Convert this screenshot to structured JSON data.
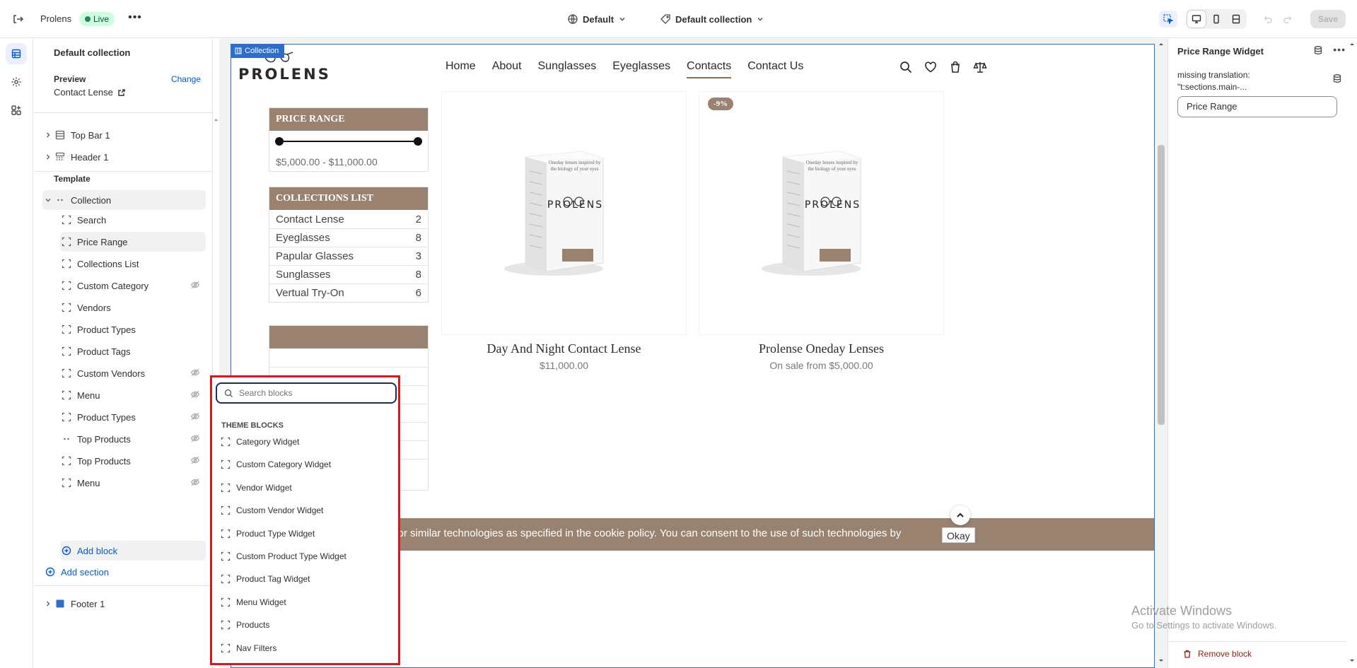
{
  "topbar": {
    "store_name": "Prolens",
    "live_badge": "Live",
    "theme_select": "Default",
    "template_select": "Default collection",
    "save_label": "Save"
  },
  "sidebar": {
    "title": "Default collection",
    "preview_label": "Preview",
    "change_label": "Change",
    "preview_value": "Contact Lense",
    "top_items": [
      {
        "label": "Top Bar 1"
      },
      {
        "label": "Header 1"
      }
    ],
    "template_label": "Template",
    "section": "Collection",
    "blocks": [
      {
        "label": "Search",
        "hidden": false
      },
      {
        "label": "Price Range",
        "hidden": false
      },
      {
        "label": "Collections List",
        "hidden": false
      },
      {
        "label": "Custom Category",
        "hidden": true
      },
      {
        "label": "Vendors",
        "hidden": false
      },
      {
        "label": "Product Types",
        "hidden": false
      },
      {
        "label": "Product Tags",
        "hidden": false
      },
      {
        "label": "Custom Vendors",
        "hidden": true
      },
      {
        "label": "Menu",
        "hidden": true
      },
      {
        "label": "Product Types",
        "hidden": true
      },
      {
        "label": "Top Products",
        "hidden": true
      },
      {
        "label": "Top Products",
        "hidden": true
      },
      {
        "label": "Menu",
        "hidden": true
      }
    ],
    "add_block": "Add block",
    "add_section": "Add section",
    "footer": "Footer 1"
  },
  "preview": {
    "collection_tag": "Collection",
    "logo": "PROLENS",
    "nav": [
      "Home",
      "About",
      "Sunglasses",
      "Eyeglasses",
      "Contacts",
      "Contact Us"
    ],
    "nav_current": "Contacts",
    "price_widget": {
      "title": "PRICE RANGE",
      "range_text": "$5,000.00 - $11,000.00",
      "min": 5000,
      "max": 11000
    },
    "collections_widget": {
      "title": "COLLECTIONS LIST",
      "items": [
        {
          "name": "Contact Lense",
          "count": "2"
        },
        {
          "name": "Eyeglasses",
          "count": "8"
        },
        {
          "name": "Papular Glasses",
          "count": "3"
        },
        {
          "name": "Sunglasses",
          "count": "8"
        },
        {
          "name": "Vertual Try-On",
          "count": "6"
        }
      ]
    },
    "products": [
      {
        "name": "Day And Night Contact Lense",
        "price": "$11,000.00",
        "badge": "",
        "box_logo": "PROLENS",
        "box_tagline": "Oneday lenses inspired by the biology of your eyes"
      },
      {
        "name": "Prolense Oneday Lenses",
        "price": "On sale from $5,000.00",
        "badge": "-9%",
        "box_logo": "PROLENS",
        "box_tagline": "Oneday lenses inspired by the biology of your eyes"
      }
    ],
    "cookie_text": "ookies or similar technologies as specified in the cookie policy. You can consent to the use of such technologies by",
    "okay": "Okay"
  },
  "watermark": {
    "line1": "Activate Windows",
    "line2": "Go to Settings to activate Windows."
  },
  "right_panel": {
    "title": "Price Range Widget",
    "label": "missing translation: \"t:sections.main-...",
    "input_value": "Price Range",
    "remove": "Remove block"
  },
  "picker": {
    "placeholder": "Search blocks",
    "header": "THEME BLOCKS",
    "items": [
      "Category Widget",
      "Custom Category Widget",
      "Vendor Widget",
      "Custom Vendor Widget",
      "Product Type Widget",
      "Custom Product Type Widget",
      "Product Tag Widget",
      "Menu Widget",
      "Products",
      "Nav Filters"
    ]
  },
  "colors": {
    "accent": "#005bd3",
    "brand_brown": "#99826f",
    "highlight_red": "#e0141e"
  }
}
